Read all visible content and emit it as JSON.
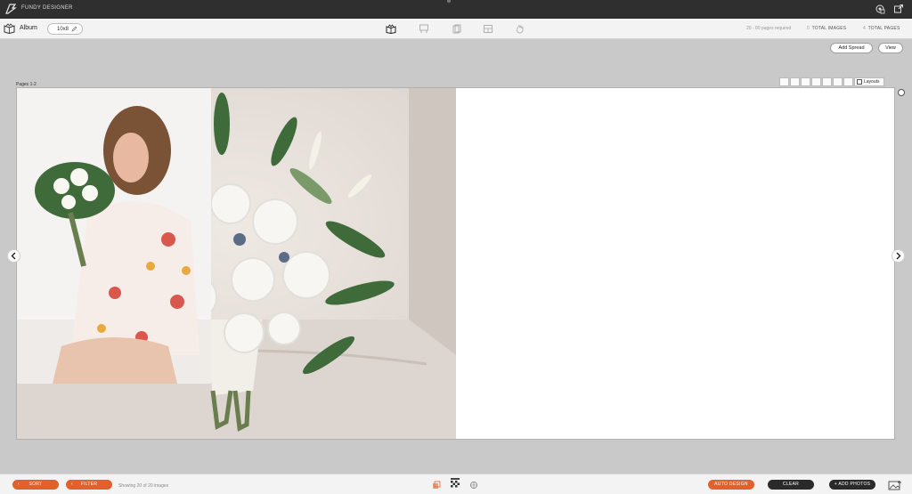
{
  "app": {
    "title": "FUNDY DESIGNER"
  },
  "toolbar": {
    "album_label": "Album",
    "album_size": "10x8",
    "pages_required": "20 - 80 pages required",
    "total_images_count": "0",
    "total_images_label": "TOTAL IMAGES",
    "total_pages_count": "4",
    "total_pages_label": "TOTAL PAGES"
  },
  "actions": {
    "add_spread": "Add Spread",
    "view": "View"
  },
  "spread": {
    "pages_label": "Pages 1-2",
    "layouts_label": "Layouts"
  },
  "bottom": {
    "sort": "SORT",
    "filter": "FILTER",
    "showing": "Showing 20 of 20 images",
    "auto_design": "AUTO DESIGN",
    "clear": "CLEAR",
    "add_photos": "+ ADD PHOTOS"
  },
  "colors": {
    "accent": "#e2602a",
    "titlebar": "#2f2f2f",
    "dark_button": "#2a2a2a"
  }
}
